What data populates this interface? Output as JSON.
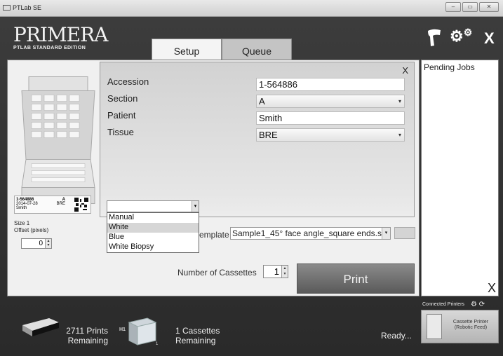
{
  "window": {
    "title": "PTLab SE",
    "controls": [
      "minimize",
      "maximize",
      "close"
    ]
  },
  "logo": {
    "brand": "PRIMERA",
    "edition": "PTLAB STANDARD EDITION"
  },
  "top_icons": {
    "scanner": "scanner-icon",
    "settings": "gears-icon",
    "exit_label": "X"
  },
  "tabs": [
    {
      "label": "Setup",
      "active": true
    },
    {
      "label": "Queue",
      "active": false
    }
  ],
  "cassette_label": {
    "line1": "1-564886",
    "line1_right": "A",
    "line2": "2014-07-28",
    "line2_right": "BRE",
    "line3": "Smith"
  },
  "left_panel": {
    "size": "Size 1",
    "offset_label": "Offset (pixels)",
    "offset_value": "0"
  },
  "form": {
    "close_label": "X",
    "fields": [
      {
        "label": "Accession",
        "value": "1-564886",
        "type": "text"
      },
      {
        "label": "Section",
        "value": "A",
        "type": "select"
      },
      {
        "label": "Patient",
        "value": "Smith",
        "type": "text"
      },
      {
        "label": "Tissue",
        "value": "BRE",
        "type": "select"
      }
    ]
  },
  "color_select": {
    "value": "",
    "options": [
      {
        "label": "Manual",
        "highlighted": false
      },
      {
        "label": "White",
        "highlighted": true
      },
      {
        "label": "Blue",
        "highlighted": false
      },
      {
        "label": "White Biopsy",
        "highlighted": false
      }
    ]
  },
  "template": {
    "label": "emplate",
    "value": "Sample1_45° face angle_square ends.s"
  },
  "cassettes": {
    "label": "Number of Cassettes",
    "value": "1"
  },
  "print_label": "Print",
  "pending": {
    "title": "Pending Jobs",
    "clear_label": "X"
  },
  "connected": {
    "label": "Connected Printers",
    "printer_name_l1": "Cassette Printer",
    "printer_name_l2": "(Robotic Feed)"
  },
  "status": {
    "prints_l1": "2711 Prints",
    "prints_l2": "Remaining",
    "hopper_tag": "H1",
    "hopper_num": "1",
    "cassettes_l1": "1 Cassettes",
    "cassettes_l2": "Remaining",
    "ready": "Ready..."
  }
}
